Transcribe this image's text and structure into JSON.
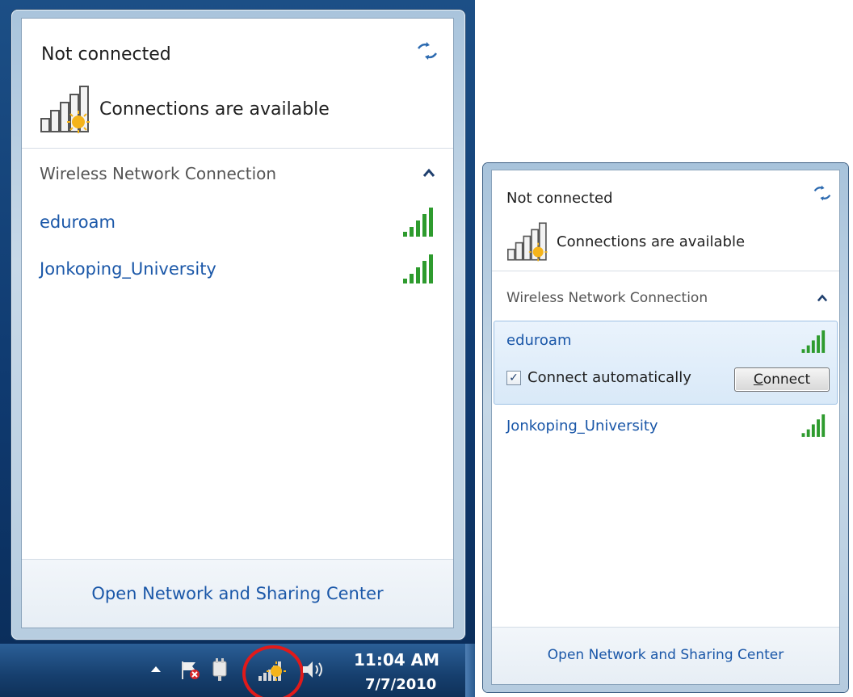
{
  "left": {
    "status": "Not connected",
    "availability": "Connections are available",
    "section_title": "Wireless Network Connection",
    "networks": [
      {
        "name": "eduroam"
      },
      {
        "name": "Jonkoping_University"
      }
    ],
    "footer_link": "Open Network and Sharing Center",
    "taskbar": {
      "time": "11:04 AM",
      "date": "7/7/2010"
    }
  },
  "right": {
    "status": "Not connected",
    "availability": "Connections are available",
    "section_title": "Wireless Network Connection",
    "networks": [
      {
        "name": "eduroam",
        "selected": true
      },
      {
        "name": "Jonkoping_University",
        "selected": false
      }
    ],
    "connect_automatically_label": "Connect automatically",
    "connect_automatically_checked": true,
    "connect_button": {
      "access_key": "C",
      "rest": "onnect"
    },
    "footer_link": "Open Network and Sharing Center"
  },
  "colors": {
    "link_blue": "#1a57a8",
    "signal_green": "#2e9b2e",
    "taskbar_blue": "#163f6e",
    "highlight_red": "#e11a1a"
  },
  "icons": {
    "refresh": "refresh-icon",
    "connections": "wifi-available-icon",
    "signal": "signal-strength-icon",
    "chevron": "chevron-up-icon",
    "tray_network": "network-tray-icon"
  }
}
